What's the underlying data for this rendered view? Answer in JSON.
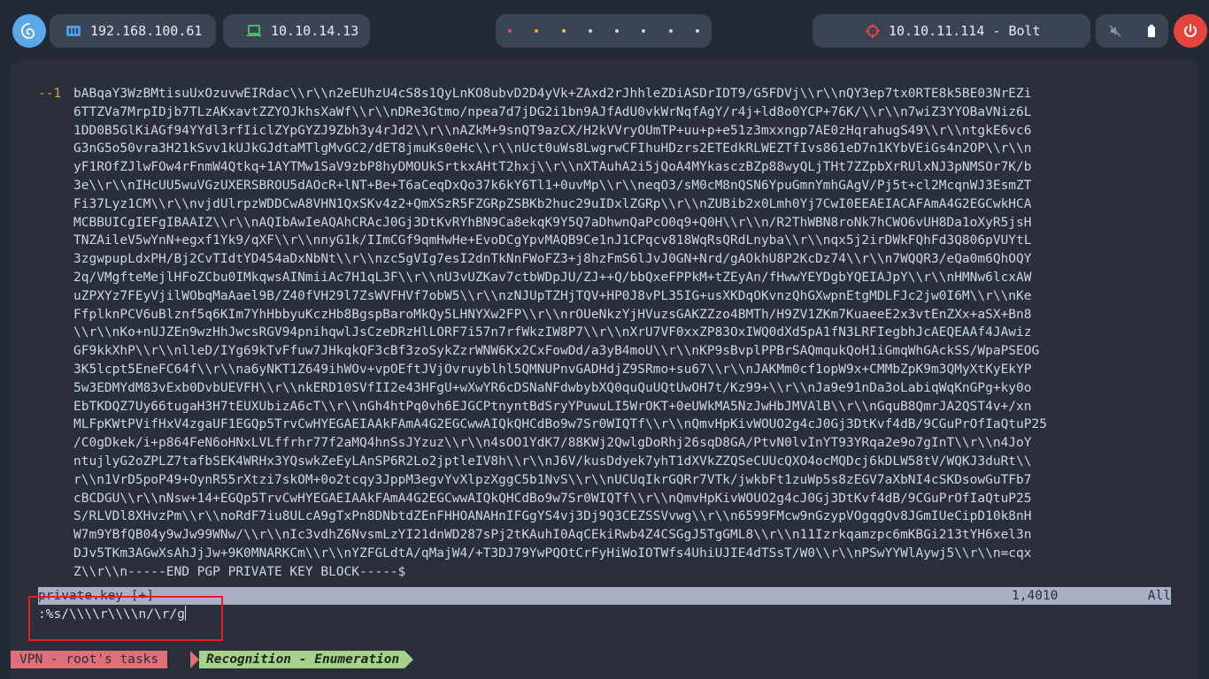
{
  "topbar": {
    "ip_local": "192.168.100.61",
    "ip_vpn": "10.10.14.13",
    "target": "10.10.11.114 - Bolt"
  },
  "colors": {
    "background": "#242a35",
    "pill": "#3b4453",
    "terminal": "#2a2f3a",
    "gutter_text": "#e0a040",
    "tmux_red": "#e07078",
    "tmux_green": "#a6d18a",
    "highlight_box": "#e02020"
  },
  "editor": {
    "gutter_marker": "--1",
    "lines": [
      "bABqaY3WzBMtisuUxOzuvwEIRdac\\\\r\\\\n2eEUhzU4cS8s1QyLnKO8ubvD2D4yVk+ZAxd2rJhhleZDiASDrIDT9/G5FDVj\\\\r\\\\nQY3ep7tx0RTE8k5BE03NrEZi",
      "6TTZVa7MrpIDjb7TLzAKxavtZZYOJkhsXaWf\\\\r\\\\nDRe3Gtmo/npea7d7jDG2i1bn9AJfAdU0vkWrNqfAgY/r4j+ld8o0YCP+76K/\\\\r\\\\n7wiZ3YYOBaVNiz6L",
      "1DD0B5GlKiAGf94YYdl3rfIiclZYpGYZJ9Zbh3y4rJd2\\\\r\\\\nAZkM+9snQT9azCX/H2kVVryOUmTP+uu+p+e51z3mxxngp7AE0zHqrahugS49\\\\r\\\\ntgkE6vc6",
      "G3nG5o50vra3H21kSvv1kUJkGJdtaMTlgMvGC2/dET8jmuKs0eHc\\\\r\\\\nUct0uWs8LwgrwCFIhuHDzrs2ETEdkRLWEZTfIvs861eD7n1KYbVEiGs4n2OP\\\\r\\\\n",
      "yF1ROfZJlwFOw4rFnmW4Qtkq+1AYTMw1SaV9zbP8hyDMOUkSrtkxAHtT2hxj\\\\r\\\\nXTAuhA2i5jQoA4MYkasczBZp88wyQLjTHt7ZZpbXrRUlxNJ3pNMSOr7K/b",
      "3e\\\\r\\\\nIHcUU5wuVGzUXERSBROU5dAOcR+lNT+Be+T6aCeqDxQo37k6kY6Tl1+0uvMp\\\\r\\\\neqO3/sM0cM8nQSN6YpuGmnYmhGAgV/Pj5t+cl2McqnWJ3EsmZT",
      "Fi37Lyz1CM\\\\r\\\\nvjdUlrpzWDDCwA8VHN1QxSKv4z2+QmXSzR5FZGRpZSBKb2huc29uIDxlZGRp\\\\r\\\\nZUBib2x0Lmh0Yj7CwI0EEAEIACAFAmA4G2EGCwkHCA",
      "MCBBUICgIEFgIBAAIZ\\\\r\\\\nAQIbAwIeAQAhCRAcJ0Gj3DtKvRYhBN9Ca8ekqK9Y5Q7aDhwnQaPcO0q9+Q0H\\\\r\\\\n/R2ThWBN8roNk7hCWO6vUH8Da1oXyR5jsH",
      "TNZAileV5wYnN+egxf1Yk9/qXF\\\\r\\\\nnyG1k/IImCGf9qmHwHe+EvoDCgYpvMAQB9Ce1nJ1CPqcv818WqRsQRdLnyba\\\\r\\\\nqx5j2irDWkFQhFd3Q806pVUYtL",
      "3zgwpupLdxPH/Bj2CvTIdtYD454aDxNbNt\\\\r\\\\nzc5gVIg7esI2dnTkNnFWoFZ3+j8hzFmS6lJvJ0GN+Nrd/gAOkhU8P2KcDz74\\\\r\\\\n7WQQR3/eQa0m6QhOQY",
      "2q/VMgfteMejlHFoZCbu0IMkqwsAINmiiAc7H1qL3F\\\\r\\\\nU3vUZKav7ctbWDpJU/ZJ++Q/bbQxeFPPkM+tZEyAn/fHwwYEYDgbYQEIAJpY\\\\r\\\\nHMNw6lcxAW",
      "uZPXYz7FEyVjilWObqMaAael9B/Z40fVH29l7ZsWVFHVf7obW5\\\\r\\\\nzNJUpTZHjTQV+HP0J8vPL35IG+usXKDqOKvnzQhGXwpnEtgMDLFJc2jw0I6M\\\\r\\\\nKe",
      "FfplknPCV6uBlznf5q6KIm7YhHbbyuKczHb8BgspBaroMkQy5LHNYXw2FP\\\\r\\\\nrOUeNkzYjHVuzsGAKZZzo4BMTh/H9ZV1ZKm7KuaeeE2x3vtEnZXx+aSX+Bn8",
      "\\\\r\\\\nKo+nUJZEn9wzHhJwcsRGV94pnihqwlJsCzeDRzHlLORF7i57n7rfWkzIW8P7\\\\r\\\\nXrU7VF0xxZP83OxIWQ0dXd5pA1fN3LRFIegbhJcAEQEAAf4JAwiz",
      "GF9kkXhP\\\\r\\\\nlleD/IYg69kTvFfuw7JHkqkQF3cBf3zoSykZzrWNW6Kx2CxFowDd/a3yB4moU\\\\r\\\\nKP9sBvplPPBrSAQmqukQoH1iGmqWhGAckSS/WpaPSEOG",
      "3K5lcpt5EneFC64f\\\\r\\\\na6yNKT1Z649ihWOv+vpOEftJVjOvruyblhl5QMNUPnvGADHdjZ9SRmo+su67\\\\r\\\\nJAKMm0cf1opW9x+CMMbZpK9m3QMyXtKyEkYP",
      "5w3EDMYdM83vExb0DvbUEVFH\\\\r\\\\nkERD10SVfII2e43HFgU+wXwYR6cDSNaNFdwbybXQ0quQuUQtUwOH7t/Kz99+\\\\r\\\\nJa9e91nDa3oLabiqWqKnGPg+ky0o",
      "EbTKDQZ7Uy66tugaH3H7tEUXUbizA6cT\\\\r\\\\nGh4htPq0vh6EJGCPtnyntBdSryYPuwuLI5WrOKT+0eUWkMA5NzJwHbJMVAlB\\\\r\\\\nGquB8QmrJA2QST4v+/xn",
      "MLFpKWtPVifHxV4zgaUF1EGQp5TrvCwHYEGAEIAAkFAmA4G2EGCwwAIQkQHCdBo9w7Sr0WIQTf\\\\r\\\\nQmvHpKivWOUO2g4cJ0Gj3DtKvf4dB/9CGuPrOfIaQtuP25",
      "/C0gDkek/i+p864FeN6oHNxLVLffrhr77f2aMQ4hnSsJYzuz\\\\r\\\\n4sOO1YdK7/88KWj2QwlgDoRhj26sqD8GA/PtvN0lvInYT93YRqa2e9o7gInT\\\\r\\\\n4JoY",
      "ntujlyG2oZPLZ7tafbSEK4WRHx3YQswkZeEyLAnSP6R2Lo2jptleIV8h\\\\r\\\\nJ6V/kusDdyek7yhT1dXVkZZQSeCUUcQXO4ocMQDcj6kDLW58tV/WQKJ3duRt\\\\",
      "r\\\\n1VrD5poP49+OynR55rXtzi7skOM+0o2tcqy3JppM3egvYvXlpzXggC5b1NvS\\\\r\\\\nUCUqIkrGQRr7VTk/jwkbFt1zuWp5s8zEGV7aXbNI4cSKDsowGuTFb7",
      "cBCDGU\\\\r\\\\nNsw+14+EGQp5TrvCwHYEGAEIAAkFAmA4G2EGCwwAIQkQHCdBo9w7Sr0WIQTf\\\\r\\\\nQmvHpKivWOUO2g4cJ0Gj3DtKvf4dB/9CGuPrOfIaQtuP25",
      "S/RLVDl8XHvzPm\\\\r\\\\noRdF7iu8ULcA9gTxPn8DNbtdZEnFHHOANAHnIFGgYS4vj3Dj9Q3CEZSSVvwg\\\\r\\\\n6599FMcw9nGzypVOgqgQv8JGmIUeCipD10k8nH",
      "W7m9YBfQB04y9wJw99WNw/\\\\r\\\\nIc3vdhZ6NvsmLzYI21dnWD287sPj2tKAuhI0AqCEkiRwb4Z4CSGgJ5TgGML8\\\\r\\\\n11Izrkqamzpc6mKBGi213tYH6xel3n",
      "DJv5TKm3AGwXsAhJjJw+9K0MNARKCm\\\\r\\\\nYZFGLdtA/qMajW4/+T3DJ79YwPQOtCrFyHiWoIOTWfs4UhiUJIE4dTSsT/W0\\\\r\\\\nPSwYYWlAywj5\\\\r\\\\n=cqx",
      "Z\\\\r\\\\n-----END PGP PRIVATE KEY BLOCK-----$"
    ]
  },
  "statusline": {
    "filename": "private.key [+]",
    "position": "1,4010",
    "scroll": "All"
  },
  "command": ":%s/\\\\\\\\r\\\\\\\\n/\\r/g",
  "tmux": {
    "session": "VPN - root's tasks",
    "window": "Recognition - Enumeration"
  }
}
